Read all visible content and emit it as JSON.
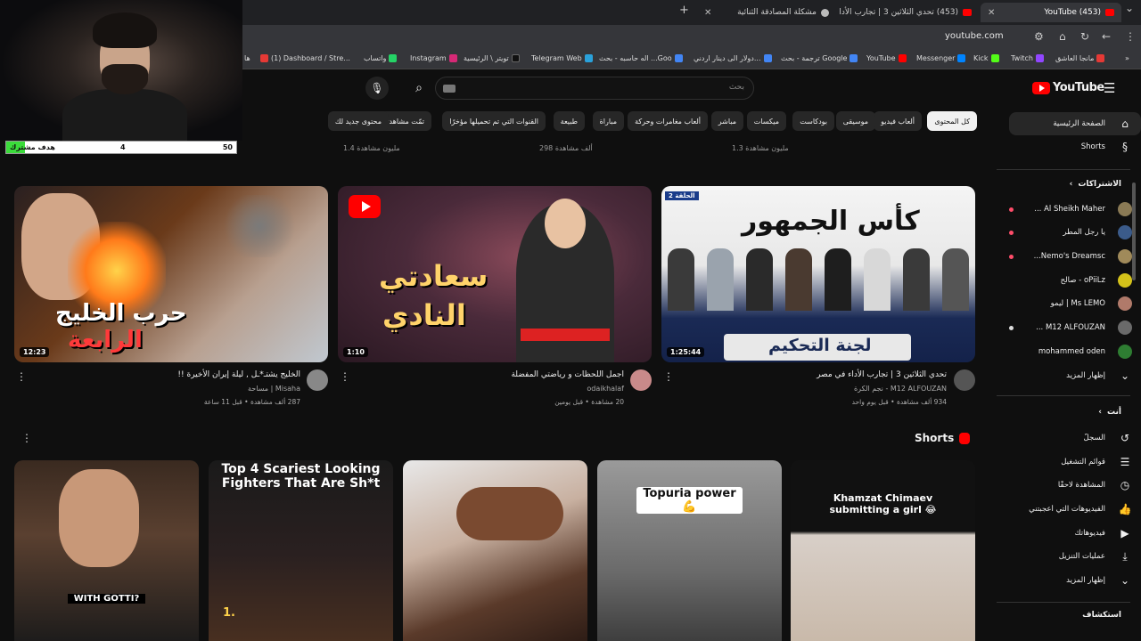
{
  "browser": {
    "tabs": [
      {
        "title": "(453) YouTube",
        "active": true
      },
      {
        "title": "(453) تحدي الثلاثين 3 | تجارب الأدا"
      },
      {
        "title": "مشكلة المصادقة الثنائية"
      }
    ],
    "url": "youtube.com",
    "bookmarks": [
      {
        "label": "مانجا العاشق",
        "color": "#e53935"
      },
      {
        "label": "Twitch",
        "color": "#9146ff"
      },
      {
        "label": "Kick",
        "color": "#53fc18"
      },
      {
        "label": "Messenger",
        "color": "#0084ff"
      },
      {
        "label": "YouTube",
        "color": "#ff0000"
      },
      {
        "label": "ترجمة - بحث Google",
        "color": "#4285f4"
      },
      {
        "label": "دولار الى دينار اردني...",
        "color": "#4285f4"
      },
      {
        "label": "اله حاسبه - بحث ...Goo",
        "color": "#4285f4"
      },
      {
        "label": "Telegram Web",
        "color": "#2aa1da"
      },
      {
        "label": "تويتر \\ الرئيسية",
        "color": "#111111"
      },
      {
        "label": "Instagram",
        "color": "#d62976"
      },
      {
        "label": "واتساب",
        "color": "#25d366"
      },
      {
        "label": "(1) Dashboard / Stre...",
        "color": "#e53935"
      },
      {
        "label": "ها",
        "color": "#e53935"
      }
    ]
  },
  "overlay": {
    "goal_label": "هدف مشترك",
    "goal_current": "4",
    "goal_target": "50",
    "goal_progress": 0.08
  },
  "header": {
    "logo_text": "YouTube",
    "search_placeholder": "بحث"
  },
  "chips": [
    "كل المحتوى",
    "ألعاب فيديو",
    "موسيقى",
    "بودكاست",
    "ميكسات",
    "مباشر",
    "ألعاب مغامرات وحركة",
    "مباراة",
    "طبيعة",
    "القنوات التي تم تحميلها مؤخرًا",
    "تمّت مشاهدتها",
    "محتوى جديد لك"
  ],
  "top_row_meta": [
    "1.3 مليون مشاهدة",
    "298 ألف مشاهدة",
    "1.4 مليون مشاهدة"
  ],
  "videos": [
    {
      "title": "تحدي الثلاثين 3 | تجارب الأداء في مصر",
      "channel": "M12 ALFOUZAN - نجم الكرة",
      "meta": "934 ألف مشاهدة • قبل يوم واحد",
      "duration": "1:25:44",
      "thumb_text_1": "كأس الجمهور",
      "thumb_text_2": "لجنة التحكيم",
      "thumb_badge": "2 الحلقة"
    },
    {
      "title": "اجمل اللحظات و رياضتي المفضلة",
      "channel": "odaikhalaf",
      "meta": "20 مشاهدة • قبل يومين",
      "duration": "1:10",
      "thumb_text_1": "سعادتي",
      "thumb_text_2": "النادي"
    },
    {
      "title": "الخليج يشتـ*ـل , ليلة إيران الأخيرة !!",
      "channel": "Misaha | مساحة",
      "meta": "287 ألف مشاهدة • قبل 11 ساعة",
      "duration": "12:23",
      "thumb_text_1": "حرب الخليج",
      "thumb_text_2": "الرابعة"
    }
  ],
  "shorts": {
    "heading": "Shorts",
    "items": [
      {
        "caption": "Khamzat Chimaev submitting a girl 😂"
      },
      {
        "caption": "Topuria power💪"
      },
      {
        "caption": ""
      },
      {
        "caption": "Top 4 Scariest Looking Fighters That Are Sh*t",
        "sub": "1."
      },
      {
        "caption": "WITH GOTTI?"
      }
    ]
  },
  "sidebar": {
    "home": "الصفحة الرئيسية",
    "shorts": "Shorts",
    "subs_heading": "الاشتراكات",
    "subscriptions": [
      {
        "name": "Al Sheikh Maher ...",
        "color": "#8a7a55",
        "live": true
      },
      {
        "name": "يا رجل المطر",
        "color": "#3b5b8a",
        "live": true
      },
      {
        "name": "Nemo's Dreamsc...",
        "color": "#a08a5a",
        "live": true
      },
      {
        "name": "oPiiLz - صالح",
        "color": "#d4c21a",
        "live": false
      },
      {
        "name": "Ms LEMO | ليمو",
        "color": "#b07a6a",
        "live": false
      },
      {
        "name": "M12 ALFOUZAN ...",
        "color": "#6a6a6a",
        "live": true
      },
      {
        "name": "mohammed oden",
        "color": "#2e7d32",
        "live": false
      }
    ],
    "show_more": "إظهار المزيد",
    "you_heading": "أنت",
    "you_items": [
      {
        "label": "السجلّ",
        "icon": "↺"
      },
      {
        "label": "قوائم التشغيل",
        "icon": "☰"
      },
      {
        "label": "المشاهدة لاحقًا",
        "icon": "◷"
      },
      {
        "label": "الفيديوهات التي أعجبتني",
        "icon": "👍"
      },
      {
        "label": "فيديوهاتك",
        "icon": "▶"
      },
      {
        "label": "عمليات التنزيل",
        "icon": "⤓"
      }
    ],
    "show_more_2": "إظهار المزيد",
    "explore_heading": "استكشاف"
  }
}
